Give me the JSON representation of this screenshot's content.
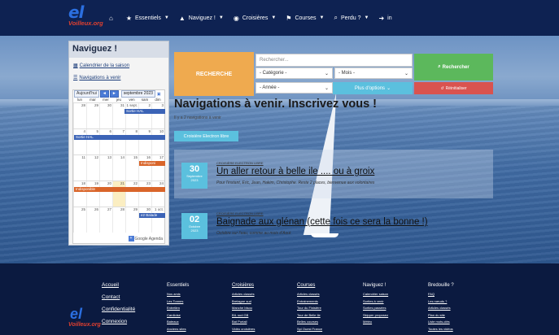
{
  "brand": {
    "logo_mark": "el",
    "logo_text": "Voilleux.org"
  },
  "nav": [
    {
      "icon": "home-icon",
      "glyph": "⌂",
      "label": ""
    },
    {
      "icon": "star-icon",
      "glyph": "★",
      "label": "Essentiels",
      "caret": true
    },
    {
      "icon": "warning-icon",
      "glyph": "▲",
      "label": "Naviguez !",
      "caret": true
    },
    {
      "icon": "compass-icon",
      "glyph": "◉",
      "label": "Croisières",
      "caret": true
    },
    {
      "icon": "flag-icon",
      "glyph": "⚑",
      "label": "Courses",
      "caret": true
    },
    {
      "icon": "search-icon",
      "glyph": "⌕",
      "label": "Perdu ?",
      "caret": true
    },
    {
      "icon": "login-icon",
      "glyph": "➜",
      "label": "in"
    }
  ],
  "sidebar": {
    "title": "Naviguez !",
    "links": [
      "Calendrier de la saison",
      "Navigations à venir"
    ],
    "calendar": {
      "today_btn": "Aujourd'hui",
      "prev": "◄",
      "next": "►",
      "month": "septembre 2023",
      "dow": [
        "lun",
        "mar",
        "mer",
        "jeu",
        "ven",
        "sam",
        "dim"
      ],
      "weeks": [
        [
          "28",
          "29",
          "30",
          "31",
          "1 sept.",
          "2",
          "3"
        ],
        [
          "4",
          "5",
          "6",
          "7",
          "8",
          "9",
          "10"
        ],
        [
          "11",
          "12",
          "13",
          "14",
          "15",
          "16",
          "17"
        ],
        [
          "18",
          "19",
          "20",
          "21",
          "22",
          "23",
          "24"
        ],
        [
          "25",
          "26",
          "27",
          "28",
          "29",
          "30",
          "1 oct."
        ]
      ],
      "events": [
        "Sortie HAL",
        "Sortie HAL",
        "Indisponi",
        "Indisponible",
        "e2 Balade"
      ],
      "footer": "Google Agenda"
    }
  },
  "search": {
    "main_label": "RECHERCHE",
    "placeholder": "Rechercher...",
    "category": "- Catégorie -",
    "month": "- Mois -",
    "year": "- Année -",
    "options": "Plus d'options",
    "submit": "Rechercher",
    "reset": "Réinitialiser"
  },
  "main": {
    "title": "Navigations à venir. Inscrivez vous !",
    "count": "Il y a 2 navigations à venir",
    "tag": "Croisière Electron libre",
    "events": [
      {
        "day": "30",
        "month": "Septembre",
        "year": "2023",
        "category": "CROISIÈRE ELECTRON LIBRE",
        "title": "Un aller retour à belle ile .... ou à groix",
        "desc": "Pour l'instant, Eric, Jean, Hakim, Christophe. Reste 2 places, bienvenue aux volontaires"
      },
      {
        "day": "02",
        "month": "Octobre",
        "year": "2023",
        "category": "CROISIÈRE ELECTRON LIBRE",
        "title": "Baignade aux glénan (cette fois ce sera la bonne !)",
        "desc": "Octobre sur l'eau, comme au mois d'Aout"
      }
    ]
  },
  "footer": {
    "main_links": [
      "Accueil",
      "Contact",
      "Confidentialité",
      "Connexion"
    ],
    "columns": [
      {
        "heading": "Essentiels",
        "underline": false,
        "links": [
          "Nos amis",
          "Les Tonnes",
          "Entretien",
          "Cardioise",
          "Bateaux",
          "Anciens sites"
        ]
      },
      {
        "heading": "Croisières",
        "underline": true,
        "links": [
          "Articles classés",
          "Bretagne sud",
          "Manche bisou",
          "BIL sud GB",
          "Bat Portail",
          "Vidéo croisières"
        ]
      },
      {
        "heading": "Courses",
        "underline": true,
        "links": [
          "Articles classés",
          "Entrainements",
          "Tour du Finistère",
          "Tour de Belle Ile",
          "Belles courses",
          "Spi Ouest France"
        ]
      },
      {
        "heading": "Naviguez !",
        "underline": false,
        "links": [
          "Calendrier saison",
          "Sorties à venir",
          "Sorties passées",
          "Skipper proposez",
          "Météo"
        ]
      },
      {
        "heading": "Bredouille ?",
        "underline": false,
        "links": [
          "FAQ",
          "Les nœuds ?",
          "Articles classés",
          "Plan du site",
          "Liste mots-clés",
          "Toutes les vidéos"
        ]
      }
    ]
  }
}
